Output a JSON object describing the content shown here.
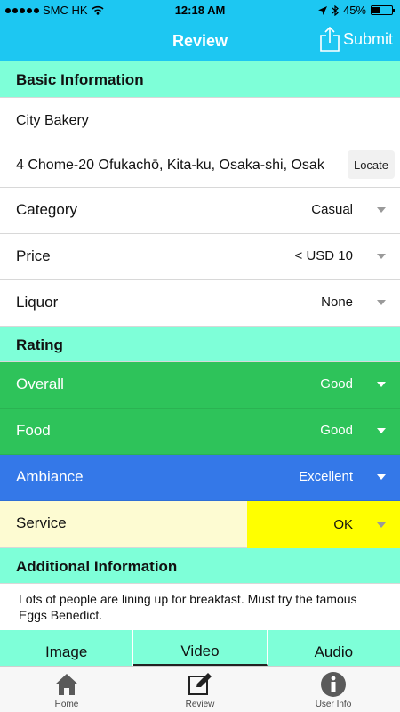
{
  "status_bar": {
    "carrier": "SMC HK",
    "time": "12:18 AM",
    "battery": "45%",
    "battery_level": 0.45
  },
  "nav": {
    "title": "Review",
    "submit_label": "Submit"
  },
  "basic_info": {
    "header": "Basic Information",
    "name": "City Bakery",
    "address": "4 Chome-20 Ōfukachō, Kita-ku, Ōsaka-shi, Ōsak",
    "locate_label": "Locate",
    "fields": [
      {
        "label": "Category",
        "value": "Casual"
      },
      {
        "label": "Price",
        "value": "< USD 10"
      },
      {
        "label": "Liquor",
        "value": "None"
      }
    ]
  },
  "rating": {
    "header": "Rating",
    "items": [
      {
        "label": "Overall",
        "value": "Good",
        "color": "#2ec35a"
      },
      {
        "label": "Food",
        "value": "Good",
        "color": "#2ec35a"
      },
      {
        "label": "Ambiance",
        "value": "Excellent",
        "color": "#3478e8"
      },
      {
        "label": "Service",
        "value": "OK",
        "color": "#fdfbd2",
        "value_color": "#ffff00"
      }
    ]
  },
  "additional": {
    "header": "Additional Information",
    "notes": "Lots of people are lining up for breakfast. Must try the famous Eggs Benedict.",
    "media_tabs": [
      {
        "label": "Image",
        "active": false
      },
      {
        "label": "Video",
        "active": true
      },
      {
        "label": "Audio",
        "active": false
      }
    ]
  },
  "tab_bar": {
    "items": [
      {
        "label": "Home",
        "icon": "home-icon"
      },
      {
        "label": "Review",
        "icon": "edit-icon",
        "active": true
      },
      {
        "label": "User Info",
        "icon": "info-icon"
      }
    ]
  }
}
